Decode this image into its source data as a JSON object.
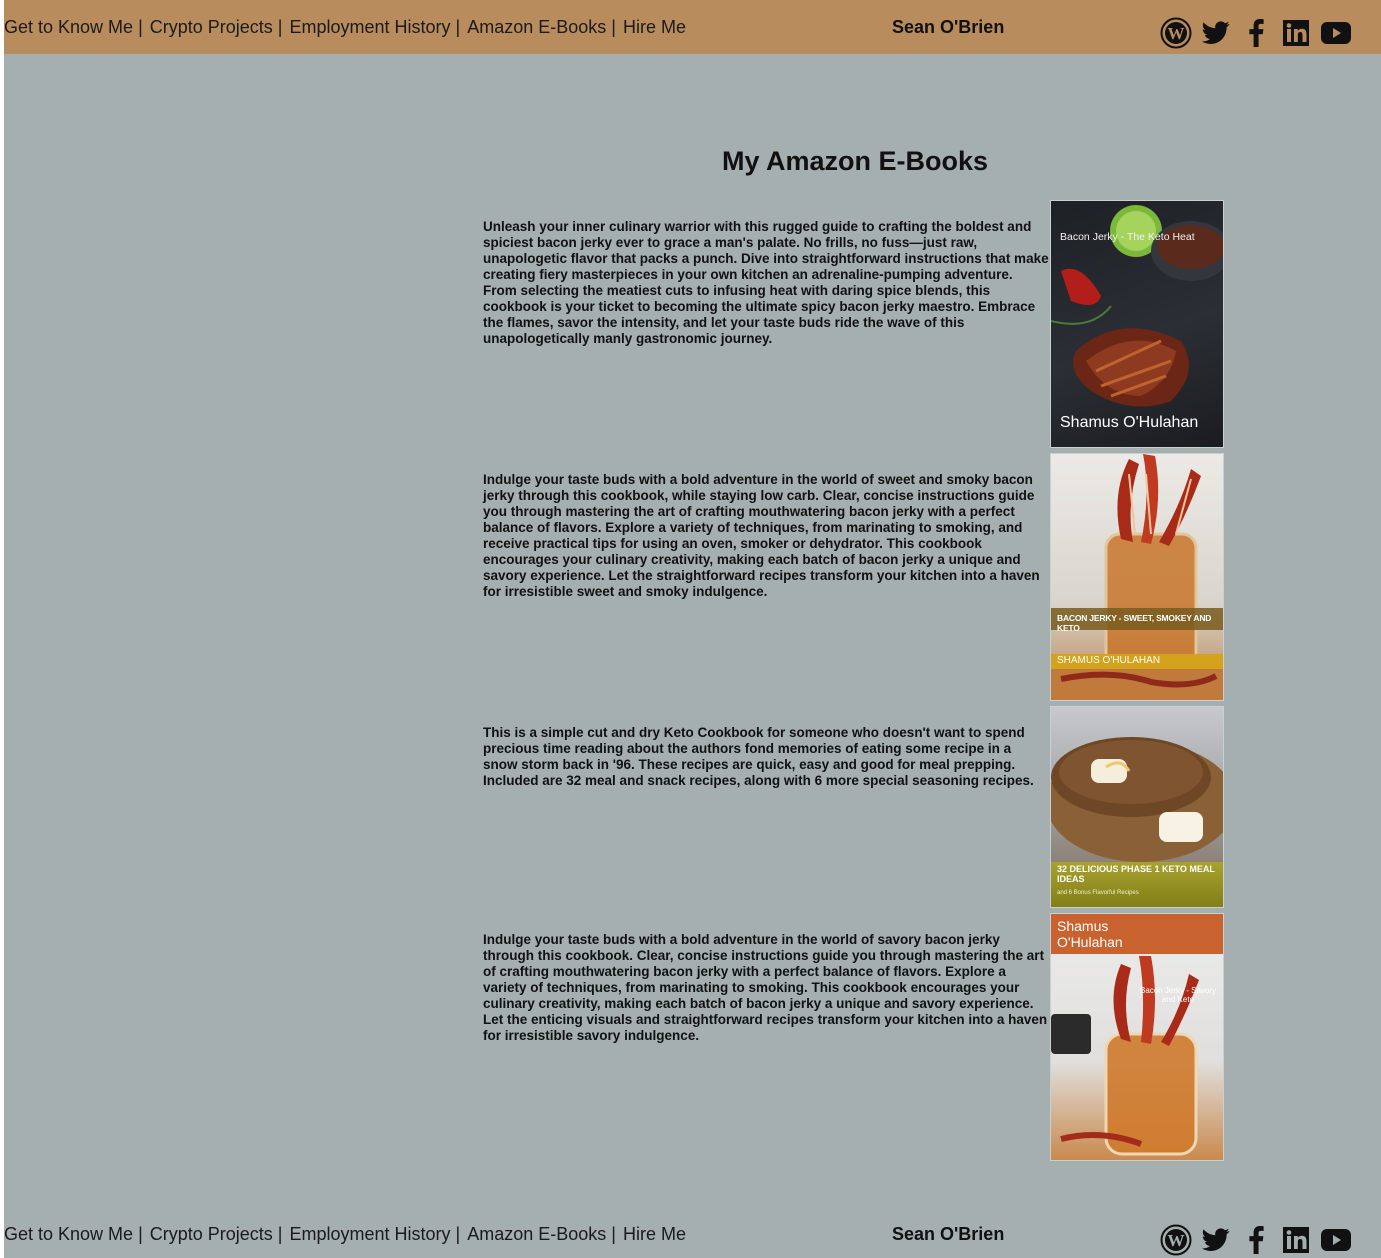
{
  "nav": {
    "items": [
      {
        "label": "Get to Know Me"
      },
      {
        "label": "Crypto Projects"
      },
      {
        "label": "Employment History"
      },
      {
        "label": "Amazon E-Books"
      },
      {
        "label": "Hire Me"
      }
    ],
    "separator": "|",
    "brand": "Sean O'Brien",
    "social": [
      "wordpress-icon",
      "twitter-icon",
      "facebook-icon",
      "linkedin-icon",
      "youtube-icon"
    ]
  },
  "main": {
    "title": "My Amazon E-Books",
    "books": [
      {
        "description": "Unleash your inner culinary warrior with this rugged guide to crafting the boldest and spiciest bacon jerky ever to grace a man's palate. No frills, no fuss—just raw, unapologetic flavor that packs a punch. Dive into straightforward instructions that make creating fiery masterpieces in your own kitchen an adrenaline-pumping adventure. From selecting the meatiest cuts to infusing heat with daring spice blends, this cookbook is your ticket to becoming the ultimate spicy bacon jerky maestro. Embrace the flames, savor the intensity, and let your taste buds ride the wave of this unapologetically manly gastronomic journey.",
        "cover_title": "Bacon Jerky - The Keto Heat",
        "cover_author": "Shamus O'Hulahan"
      },
      {
        "description": "Indulge your taste buds with a bold adventure in the world of sweet and smoky bacon jerky through this cookbook, while staying low carb. Clear, concise instructions guide you through mastering the art of crafting mouthwatering bacon jerky with a perfect balance of flavors. Explore a variety of techniques, from marinating to smoking, and receive practical tips for using an oven, smoker or dehydrator. This cookbook encourages your culinary creativity, making each batch of bacon jerky a unique and savory experience. Let the straightforward recipes transform your kitchen into a haven for irresistible sweet and smoky indulgence.",
        "cover_title": "BACON JERKY - SWEET, SMOKEY AND KETO",
        "cover_author": "SHAMUS O'HULAHAN"
      },
      {
        "description": "This is a simple cut and dry Keto Cookbook for someone who doesn't want to spend precious time reading about the authors fond memories of eating some recipe in a snow storm back in '96. These recipes are quick, easy and good for meal prepping. Included are 32 meal and snack recipes, along with 6 more special seasoning recipes.",
        "cover_title": "32 DELICIOUS PHASE 1 KETO MEAL IDEAS",
        "cover_subtitle": "and 6 Bonus Flavorful Recipes"
      },
      {
        "description": "Indulge your taste buds with a bold adventure in the world of savory bacon jerky through this cookbook. Clear, concise instructions guide you through mastering the art of crafting mouthwatering bacon jerky with a perfect balance of flavors. Explore a variety of techniques, from marinating to smoking. This cookbook encourages your culinary creativity, making each batch of bacon jerky a unique and savory experience. Let the enticing visuals and straightforward recipes transform your kitchen into a haven for irresistible savory indulgence.",
        "cover_author": "Shamus O'Hulahan",
        "cover_title": "Bacon Jerky - Savory and Keto"
      }
    ]
  },
  "colors": {
    "header_bg": "#b98c5e",
    "page_bg": "#a5afb0"
  }
}
